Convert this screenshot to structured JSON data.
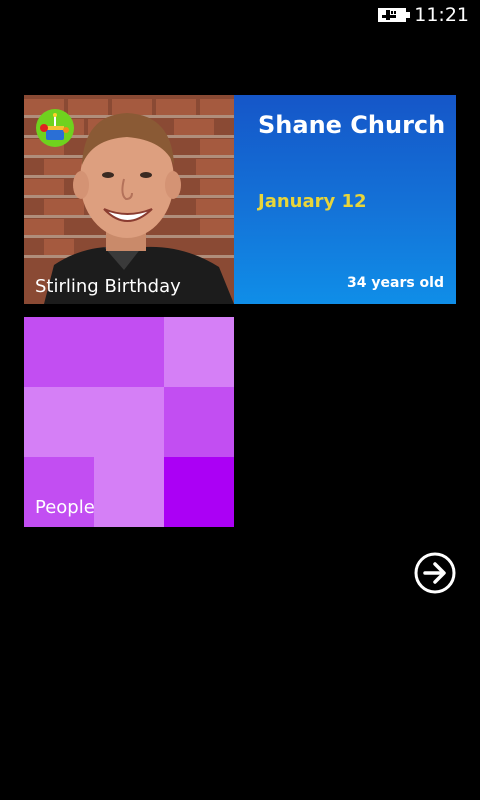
{
  "status_bar": {
    "time": "11:21",
    "battery_icon": "battery-charging-icon"
  },
  "birthday_tile": {
    "caption": "Stirling Birthday",
    "name": "Shane Church",
    "date": "January 12",
    "age": "34 years old",
    "app_icon": "cake-app-icon",
    "accent_color": "#1473d8",
    "date_color": "#e8d53a"
  },
  "people_tile": {
    "label": "People",
    "colors": [
      "#c24ef2",
      "#d57ff6",
      "#ab00f5"
    ]
  },
  "more_button": {
    "icon": "arrow-right-icon"
  }
}
